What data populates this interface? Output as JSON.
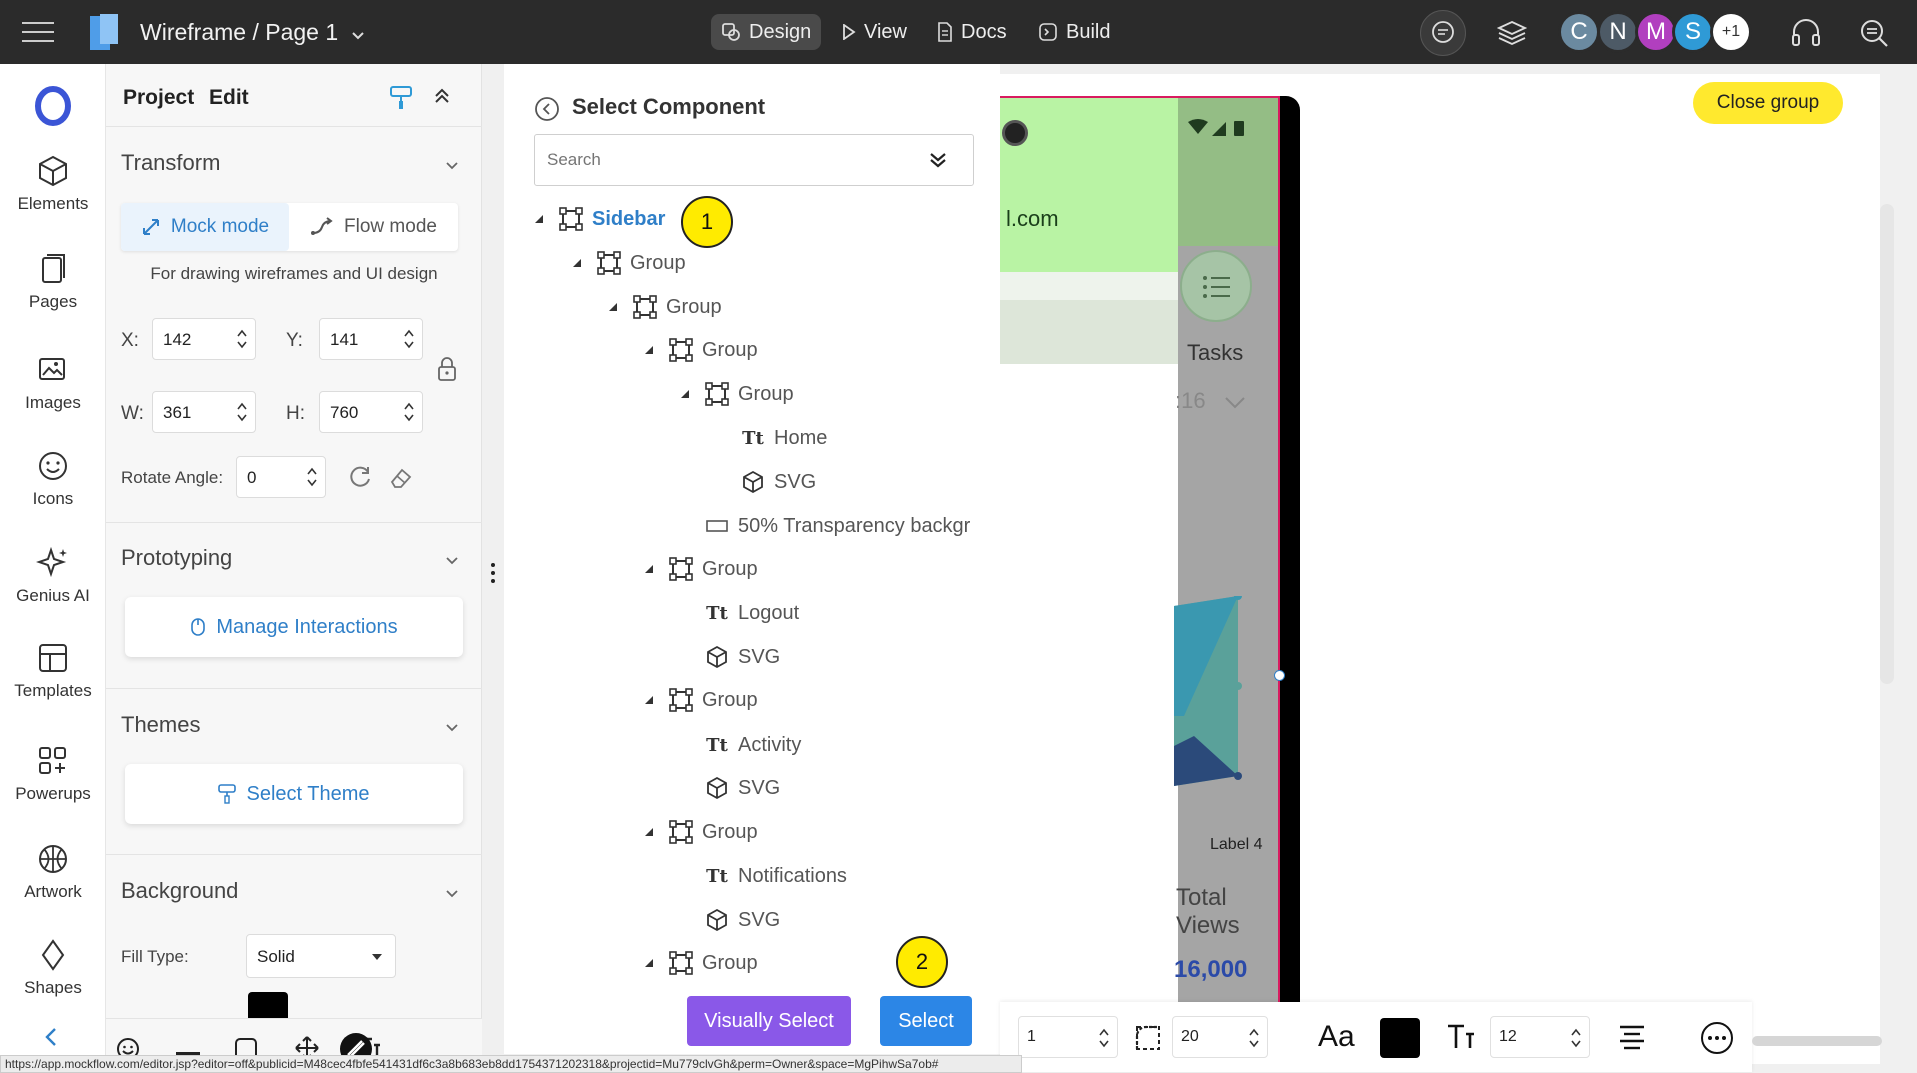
{
  "topbar": {
    "title": "Wireframe / Page 1",
    "nav": [
      {
        "label": "Design",
        "icon": "design-icon"
      },
      {
        "label": "View",
        "icon": "play-icon"
      },
      {
        "label": "Docs",
        "icon": "doc-icon"
      },
      {
        "label": "Build",
        "icon": "build-icon"
      }
    ],
    "avatars": [
      {
        "letter": "C",
        "color": "#6b8aa0"
      },
      {
        "letter": "N",
        "color": "#4d5a66"
      },
      {
        "letter": "M",
        "color": "#b13fbf"
      },
      {
        "letter": "S",
        "color": "#2f9ad6"
      },
      {
        "letter": "+1",
        "color": "#ffffff"
      }
    ]
  },
  "rail": {
    "items": [
      {
        "label": "Elements",
        "icon": "cube-icon"
      },
      {
        "label": "Pages",
        "icon": "pages-icon"
      },
      {
        "label": "Images",
        "icon": "images-icon"
      },
      {
        "label": "Icons",
        "icon": "smiley-icon"
      },
      {
        "label": "Genius AI",
        "icon": "sparkle-icon"
      },
      {
        "label": "Templates",
        "icon": "templates-icon"
      },
      {
        "label": "Powerups",
        "icon": "powerups-icon"
      },
      {
        "label": "Artwork",
        "icon": "artwork-icon"
      },
      {
        "label": "Shapes",
        "icon": "diamond-icon"
      }
    ]
  },
  "props": {
    "tabs": [
      "Project",
      "Edit"
    ],
    "transform": {
      "title": "Transform",
      "mock_mode": "Mock mode",
      "flow_mode": "Flow mode",
      "hint": "For drawing wireframes and UI design",
      "x_label": "X:",
      "x": "142",
      "y_label": "Y:",
      "y": "141",
      "w_label": "W:",
      "w": "361",
      "h_label": "H:",
      "h": "760",
      "rotate_label": "Rotate Angle:",
      "rotate": "0"
    },
    "prototyping": {
      "title": "Prototyping",
      "button": "Manage Interactions"
    },
    "themes": {
      "title": "Themes",
      "button": "Select Theme"
    },
    "background": {
      "title": "Background",
      "fill_label": "Fill Type:",
      "fill_value": "Solid"
    }
  },
  "select_component": {
    "title": "Select Component",
    "search_placeholder": "Search",
    "tree": [
      {
        "label": "Sidebar",
        "type": "group",
        "tri": true
      },
      {
        "label": "Group",
        "type": "group",
        "tri": true
      },
      {
        "label": "Group",
        "type": "group",
        "tri": true
      },
      {
        "label": "Group",
        "type": "group",
        "tri": true
      },
      {
        "label": "Group",
        "type": "group",
        "tri": true
      },
      {
        "label": "Home",
        "type": "text",
        "tri": false
      },
      {
        "label": "SVG",
        "type": "svg",
        "tri": false
      },
      {
        "label": "50% Transparency backgr",
        "type": "rect",
        "tri": false
      },
      {
        "label": "Group",
        "type": "group",
        "tri": true
      },
      {
        "label": "Logout",
        "type": "text",
        "tri": false
      },
      {
        "label": "SVG",
        "type": "svg",
        "tri": false
      },
      {
        "label": "Group",
        "type": "group",
        "tri": true
      },
      {
        "label": "Activity",
        "type": "text",
        "tri": false
      },
      {
        "label": "SVG",
        "type": "svg",
        "tri": false
      },
      {
        "label": "Group",
        "type": "group",
        "tri": true
      },
      {
        "label": "Notifications",
        "type": "text",
        "tri": false
      },
      {
        "label": "SVG",
        "type": "svg",
        "tri": false
      },
      {
        "label": "Group",
        "type": "group",
        "tri": true
      }
    ],
    "text_glyph": "Tt",
    "visually_select": "Visually Select",
    "select": "Select"
  },
  "canvas": {
    "close_group": "Close group",
    "email_fragment": "l.com",
    "tasks": "Tasks",
    "date_fragment": ":16",
    "chart_label": "Label 4",
    "total_line1": "Total",
    "total_line2": "Views",
    "total_value": "16,000"
  },
  "callouts": {
    "one": "1",
    "two": "2"
  },
  "bottombar": {
    "stroke": "1",
    "radius": "20",
    "font_glyph": "Aa",
    "font_size": "12"
  },
  "status_url": "https://app.mockflow.com/editor.jsp?editor=off&publicid=M48cec4fbfe541431df6c3a8b683eb8dd1754371202318&projectid=Mu779clvGh&perm=Owner&space=MgPihwSa7ob#",
  "colors": {
    "accent": "#2f7fc8",
    "select_btn": "#2c86e6",
    "visual_btn": "#8a58e8",
    "callout": "#ffeb00"
  }
}
